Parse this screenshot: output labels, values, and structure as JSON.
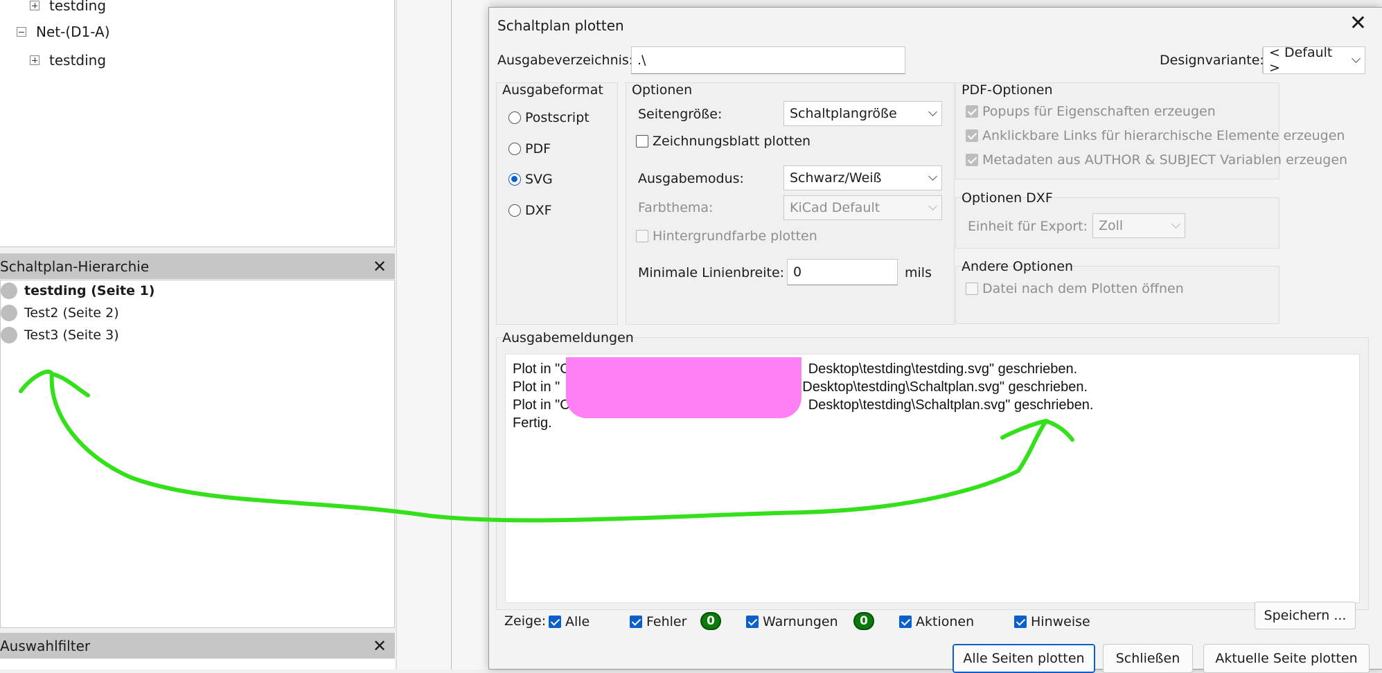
{
  "tree": {
    "items": [
      {
        "label": "testding",
        "expander": "plus"
      },
      {
        "label": "Net-(D1-A)",
        "expander": "minus"
      },
      {
        "label": "testding",
        "expander": "plus"
      }
    ]
  },
  "hierarchy": {
    "title": "Schaltplan-Hierarchie",
    "items": [
      {
        "label": "testding (Seite 1)",
        "bold": true
      },
      {
        "label": "Test2 (Seite 2)",
        "bold": false
      },
      {
        "label": "Test3 (Seite 3)",
        "bold": false
      }
    ]
  },
  "selection_filter": {
    "title": "Auswahlfilter"
  },
  "dialog": {
    "title": "Schaltplan plotten",
    "output_dir_label": "Ausgabeverzeichnis:",
    "output_dir_value": ".\\",
    "design_variant_label": "Designvariante:",
    "design_variant_value": "< Default >",
    "format_group": {
      "title": "Ausgabeformat",
      "options": [
        "Postscript",
        "PDF",
        "SVG",
        "DXF"
      ],
      "selected": "SVG"
    },
    "options_group": {
      "title": "Optionen",
      "page_size_label": "Seitengröße:",
      "page_size_value": "Schaltplangröße",
      "plot_frame_label": "Zeichnungsblatt plotten",
      "output_mode_label": "Ausgabemodus:",
      "output_mode_value": "Schwarz/Weiß",
      "color_theme_label": "Farbthema:",
      "color_theme_value": "KiCad Default",
      "bg_color_label": "Hintergrundfarbe plotten",
      "min_line_width_label": "Minimale Linienbreite:",
      "min_line_width_value": "0",
      "min_line_width_unit": "mils"
    },
    "pdf_group": {
      "title": "PDF-Optionen",
      "items": [
        "Popups für Eigenschaften erzeugen",
        "Anklickbare Links für hierarchische Elemente erzeugen",
        "Metadaten aus AUTHOR & SUBJECT Variablen erzeugen"
      ]
    },
    "dxf_group": {
      "title": "Optionen DXF",
      "unit_label": "Einheit für Export:",
      "unit_value": "Zoll"
    },
    "other_group": {
      "title": "Andere Optionen",
      "open_after_label": "Datei nach dem Plotten öffnen"
    },
    "messages": {
      "title": "Ausgabemeldungen",
      "lines": [
        {
          "prefix": "Plot in \"C",
          "suffix": "Desktop\\testding\\testding.svg\" geschrieben."
        },
        {
          "prefix": "Plot in \"",
          "suffix": "Desktop\\testding\\Schaltplan.svg\" geschrieben."
        },
        {
          "prefix": "Plot in \"C",
          "suffix": "Desktop\\testding\\Schaltplan.svg\" geschrieben."
        },
        {
          "prefix": "Fertig.",
          "suffix": ""
        }
      ]
    },
    "filters": {
      "show_label": "Zeige:",
      "all_label": "Alle",
      "errors_label": "Fehler",
      "errors_count": "0",
      "warnings_label": "Warnungen",
      "warnings_count": "0",
      "actions_label": "Aktionen",
      "infos_label": "Hinweise"
    },
    "save_label": "Speichern ...",
    "buttons": {
      "plot_all": "Alle Seiten plotten",
      "close": "Schließen",
      "plot_current": "Aktuelle Seite plotten"
    }
  },
  "colors": {
    "accent": "#0a60c8",
    "badge": "#0b7a0b",
    "annotation": "#33e01a",
    "redaction": "#ff80f5"
  }
}
